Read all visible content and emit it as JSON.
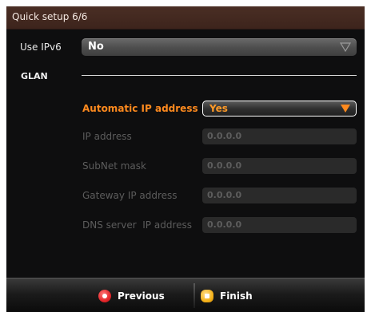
{
  "window": {
    "title": "Quick setup 6/6"
  },
  "ipv6": {
    "label": "Use IPv6",
    "value": "No"
  },
  "glan": {
    "section_label": "GLAN",
    "auto_ip": {
      "label": "Automatic IP address",
      "value": "Yes"
    },
    "fields": [
      {
        "label": "IP address",
        "value": "0.0.0.0"
      },
      {
        "label": "SubNet mask",
        "value": "0.0.0.0"
      },
      {
        "label": "Gateway IP address",
        "value": "0.0.0.0"
      },
      {
        "label": "DNS server  IP address",
        "value": "0.0.0.0"
      }
    ]
  },
  "footer": {
    "previous_label": "Previous",
    "finish_label": "Finish"
  },
  "colors": {
    "accent": "#ff8a1e",
    "title_bar": "#4a2e24",
    "previous_icon": "#e3262a",
    "finish_icon": "#f4b21c"
  }
}
